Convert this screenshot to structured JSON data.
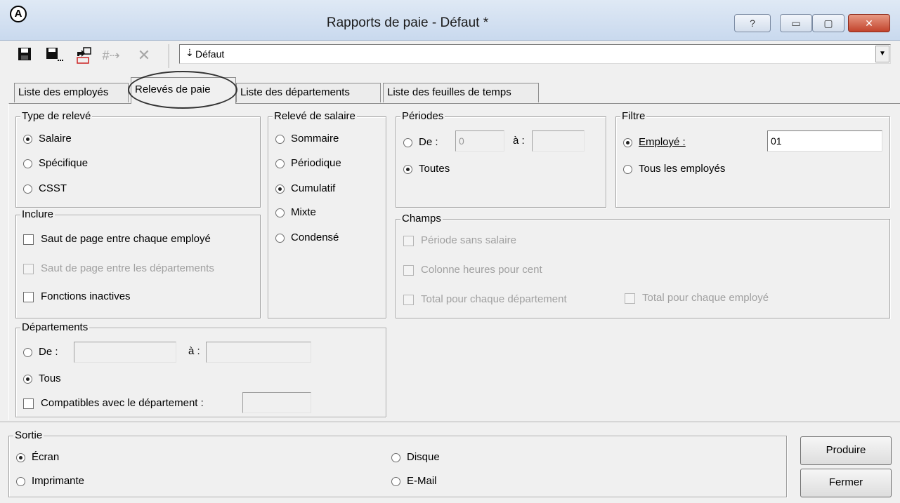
{
  "window": {
    "title": "Rapports de paie - Défaut *",
    "help_glyph": "?",
    "min_glyph": "▭",
    "max_glyph": "▢",
    "close_glyph": "✕",
    "app_glyph": "A"
  },
  "toolbar": {
    "preset_value": "Défaut",
    "preset_marker": "⇣",
    "dropdown_glyph": "▼"
  },
  "tabs": [
    "Liste des employés",
    "Relevés de paie",
    "Liste des départements",
    "Liste des feuilles de temps"
  ],
  "type_releve": {
    "title": "Type de relevé",
    "options": [
      "Salaire",
      "Spécifique",
      "CSST"
    ],
    "selected": "Salaire"
  },
  "releve_salaire": {
    "title": "Relevé de salaire",
    "options": [
      "Sommaire",
      "Périodique",
      "Cumulatif",
      "Mixte",
      "Condensé"
    ],
    "selected": "Cumulatif"
  },
  "periodes": {
    "title": "Périodes",
    "de_label": "De :",
    "from_value": "0",
    "a_label": "à :",
    "to_value": "",
    "toutes_label": "Toutes",
    "selected": "Toutes"
  },
  "filtre": {
    "title": "Filtre",
    "employe_label": "Employé :",
    "employe_value": "01",
    "tous_label": "Tous les employés",
    "selected": "Employé"
  },
  "inclure": {
    "title": "Inclure",
    "options": [
      "Saut de page entre chaque employé",
      "Saut de page entre les départements",
      "Fonctions inactives"
    ]
  },
  "champs": {
    "title": "Champs",
    "options": [
      "Période sans salaire",
      "Colonne heures pour cent",
      "Total pour chaque département",
      "Total pour chaque employé"
    ]
  },
  "departements": {
    "title": "Départements",
    "de_label": "De :",
    "a_label": "à :",
    "from_value": "",
    "to_value": "",
    "tous_label": "Tous",
    "compat_label": "Compatibles avec le département :",
    "compat_value": "",
    "selected": "Tous"
  },
  "sortie": {
    "title": "Sortie",
    "options": [
      "Écran",
      "Imprimante",
      "Disque",
      "E-Mail"
    ],
    "selected": "Écran"
  },
  "buttons": {
    "produire": "Produire",
    "fermer": "Fermer"
  }
}
